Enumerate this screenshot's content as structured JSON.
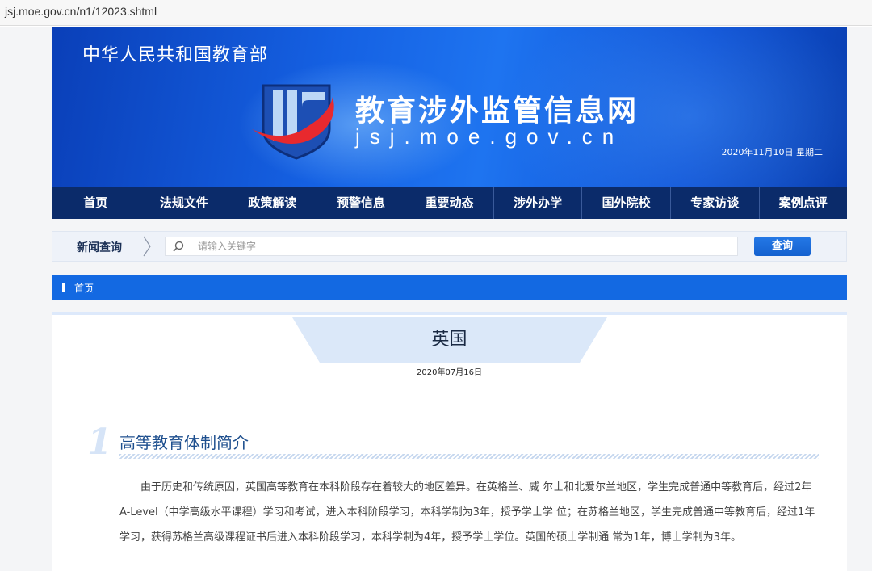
{
  "browser": {
    "url": "jsj.moe.gov.cn/n1/12023.shtml"
  },
  "banner": {
    "ministry": "中华人民共和国教育部",
    "site_title": "教育涉外监管信息网",
    "site_domain": "jsj.moe.gov.cn",
    "date": "2020年11月10日 星期二"
  },
  "nav": {
    "items": [
      "首页",
      "法规文件",
      "政策解读",
      "预警信息",
      "重要动态",
      "涉外办学",
      "国外院校",
      "专家访谈",
      "案例点评"
    ]
  },
  "search": {
    "label": "新闻查询",
    "placeholder": "请输入关键字",
    "button": "查询"
  },
  "breadcrumb": {
    "home": "首页"
  },
  "article": {
    "title": "英国",
    "date": "2020年07月16日",
    "section_number": "1",
    "section_title": "高等教育体制简介",
    "paragraph": "由于历史和传统原因，英国高等教育在本科阶段存在着较大的地区差异。在英格兰、威 尔士和北爱尔兰地区，学生完成普通中等教育后，经过2年A-Level（中学高级水平课程）学习和考试，进入本科阶段学习，本科学制为3年，授予学士学 位；在苏格兰地区，学生完成普通中等教育后，经过1年学习，获得苏格兰高级课程证书后进入本科阶段学习，本科学制为4年，授予学士学位。英国的硕士学制通 常为1年，博士学制为3年。"
  },
  "colors": {
    "nav_bg": "#0b2b6a",
    "accent_blue": "#1369e2",
    "logo_red": "#e8292e"
  }
}
